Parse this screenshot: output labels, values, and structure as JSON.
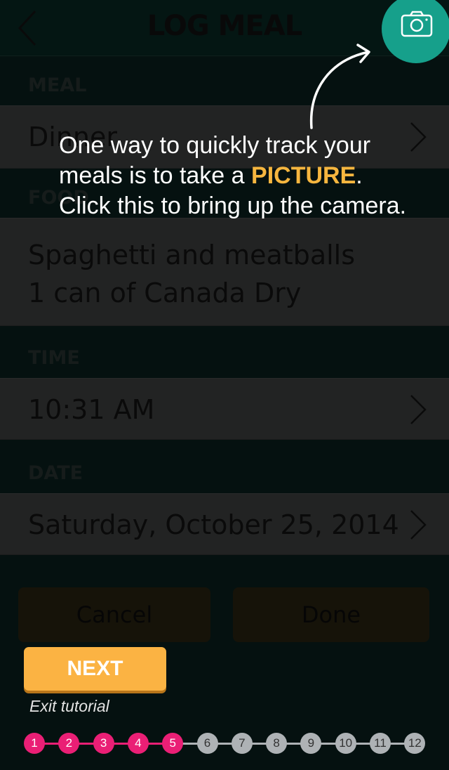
{
  "header": {
    "title": "LOG MEAL"
  },
  "meal": {
    "label": "MEAL",
    "value": "Dinner"
  },
  "food": {
    "label": "FOOD",
    "lines": [
      "Spaghetti and meatballs",
      "1 can of Canada Dry"
    ]
  },
  "time": {
    "label": "TIME",
    "value": "10:31 AM"
  },
  "date": {
    "label": "DATE",
    "value": "Saturday, October 25, 2014"
  },
  "actions": {
    "cancel": "Cancel",
    "done": "Done"
  },
  "tutorial": {
    "text_before": "One way to quickly track your meals is to take a ",
    "highlight": "PICTURE",
    "text_after": ". Click this to bring up the camera.",
    "next_label": "NEXT",
    "exit_label": "Exit tutorial",
    "steps": [
      "1",
      "2",
      "3",
      "4",
      "5",
      "6",
      "7",
      "8",
      "9",
      "10",
      "11",
      "12"
    ],
    "current_step": 5
  },
  "icons": {
    "back": "chevron-left-icon",
    "camera": "camera-icon",
    "row": "chevron-right-icon"
  },
  "colors": {
    "accent": "#16a08b",
    "highlight": "#f6b63f",
    "step_done": "#ea1f75"
  }
}
